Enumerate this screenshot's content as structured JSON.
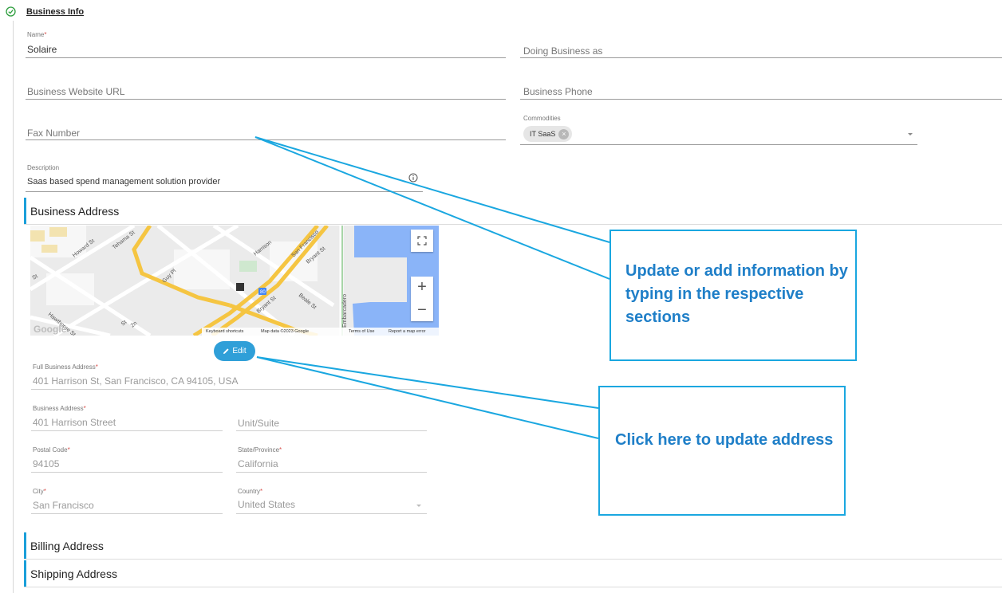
{
  "section_title": "Business Info",
  "fields": {
    "name": {
      "label": "Name",
      "value": "Solaire"
    },
    "dba": {
      "placeholder": "Doing Business as"
    },
    "website": {
      "placeholder": "Business Website URL"
    },
    "phone": {
      "placeholder": "Business Phone"
    },
    "fax": {
      "placeholder": "Fax Number"
    },
    "commodities": {
      "label": "Commodities",
      "chips": [
        "IT SaaS"
      ]
    },
    "description": {
      "label": "Description",
      "value": "Saas based spend management solution provider"
    }
  },
  "business_address": {
    "title": "Business Address",
    "map": {
      "streets": [
        "Howard St",
        "Tehama St",
        "Harrison",
        "San Francisco",
        "Guy Pl",
        "Bryant St",
        "St",
        "Hawthorne St",
        "Beale St",
        "Bryant St",
        "Embarcadero",
        "St",
        "2n",
        "80"
      ],
      "logo": "Google",
      "attribution": [
        "Keyboard shortcuts",
        "Map data ©2023 Google",
        "Terms of Use",
        "Report a map error"
      ],
      "zoom_in": "+",
      "zoom_out": "−"
    },
    "edit_label": "Edit",
    "full_address": {
      "label": "Full Business Address",
      "value": "401 Harrison St, San Francisco, CA 94105, USA"
    },
    "street": {
      "label": "Business Address",
      "value": "401 Harrison Street"
    },
    "unit": {
      "placeholder": "Unit/Suite"
    },
    "postal": {
      "label": "Postal Code",
      "value": "94105"
    },
    "state": {
      "label": "State/Province",
      "value": "California"
    },
    "city": {
      "label": "City",
      "value": "San Francisco"
    },
    "country": {
      "label": "Country",
      "value": "United States"
    }
  },
  "billing_title": "Billing Address",
  "shipping_title": "Shipping Address",
  "callouts": [
    {
      "text": "Update or add information by typing in the respective sections"
    },
    {
      "text": "Click here to update address"
    }
  ],
  "colors": {
    "accent": "#1a9fd9",
    "callout_text": "#1f7fc8",
    "callout_border": "#1aa7e0",
    "required": "#d9534f"
  }
}
